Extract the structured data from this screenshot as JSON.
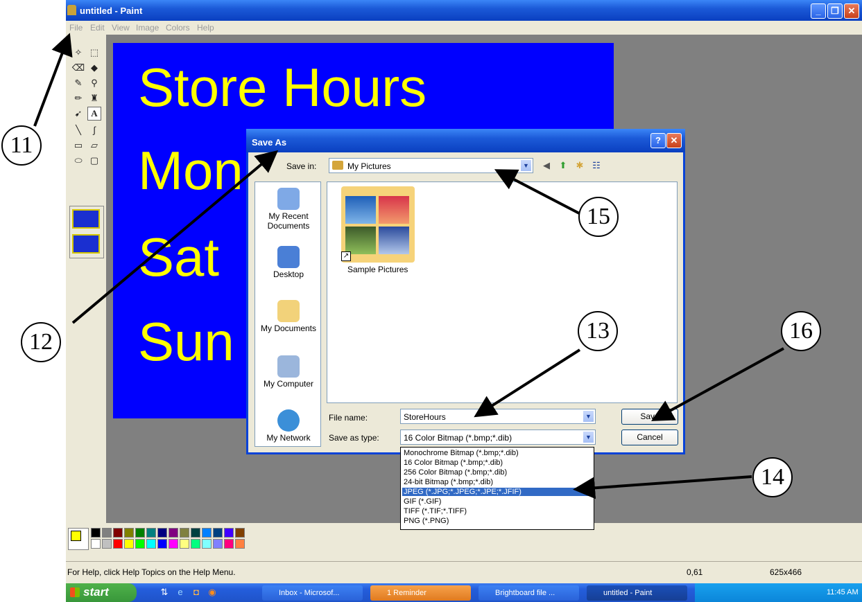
{
  "window": {
    "title": "untitled - Paint",
    "controls": [
      "_",
      "❐",
      "✕"
    ]
  },
  "menubar": [
    "File",
    "Edit",
    "View",
    "Image",
    "Colors",
    "Help"
  ],
  "toolbox": {
    "tools": [
      "free-select",
      "rect-select",
      "eraser",
      "fill",
      "color-picker",
      "magnifier",
      "pencil",
      "brush",
      "airbrush",
      "text",
      "line",
      "curve",
      "rectangle",
      "polygon",
      "ellipse",
      "rounded-rect"
    ],
    "text_tool_label": "A"
  },
  "canvas": {
    "background": "#0000ff",
    "text_color": "#ffff00",
    "lines": [
      "Store Hours",
      "Mon",
      "Sat",
      "Sun"
    ]
  },
  "palette": {
    "row1": [
      "#000000",
      "#808080",
      "#800000",
      "#808000",
      "#008000",
      "#008080",
      "#000080",
      "#800080",
      "#808040",
      "#004040",
      "#0080ff",
      "#004080",
      "#4000ff",
      "#804000"
    ],
    "row2": [
      "#ffffff",
      "#c0c0c0",
      "#ff0000",
      "#ffff00",
      "#00ff00",
      "#00ffff",
      "#0000ff",
      "#ff00ff",
      "#ffff80",
      "#00ff80",
      "#80ffff",
      "#8080ff",
      "#ff0080",
      "#ff8040"
    ]
  },
  "statusbar": {
    "help": "For Help, click Help Topics on the Help Menu.",
    "coords": "0,61",
    "size": "625x466"
  },
  "dialog": {
    "title": "Save As",
    "help_btn": "?",
    "close_btn": "✕",
    "save_in_label": "Save in:",
    "save_in_value": "My Pictures",
    "places": [
      "My Recent Documents",
      "Desktop",
      "My Documents",
      "My Computer",
      "My Network"
    ],
    "folder": "Sample Pictures",
    "file_name_label": "File name:",
    "file_name_value": "StoreHours",
    "save_type_label": "Save as type:",
    "save_type_value": "16 Color Bitmap (*.bmp;*.dib)",
    "save_btn": "Save",
    "cancel_btn": "Cancel",
    "type_options": [
      "Monochrome Bitmap (*.bmp;*.dib)",
      "16 Color Bitmap (*.bmp;*.dib)",
      "256 Color Bitmap (*.bmp;*.dib)",
      "24-bit Bitmap (*.bmp;*.dib)",
      "JPEG (*.JPG;*.JPEG;*.JPE;*.JFIF)",
      "GIF (*.GIF)",
      "TIFF (*.TIF;*.TIFF)",
      "PNG (*.PNG)"
    ],
    "highlighted_option": 4
  },
  "taskbar": {
    "start": "start",
    "buttons": [
      "Inbox - Microsof...",
      "1 Reminder",
      "Brightboard file ...",
      "untitled - Paint"
    ],
    "clock": "11:45 AM"
  },
  "callouts": [
    "11",
    "12",
    "13",
    "14",
    "15",
    "16"
  ]
}
